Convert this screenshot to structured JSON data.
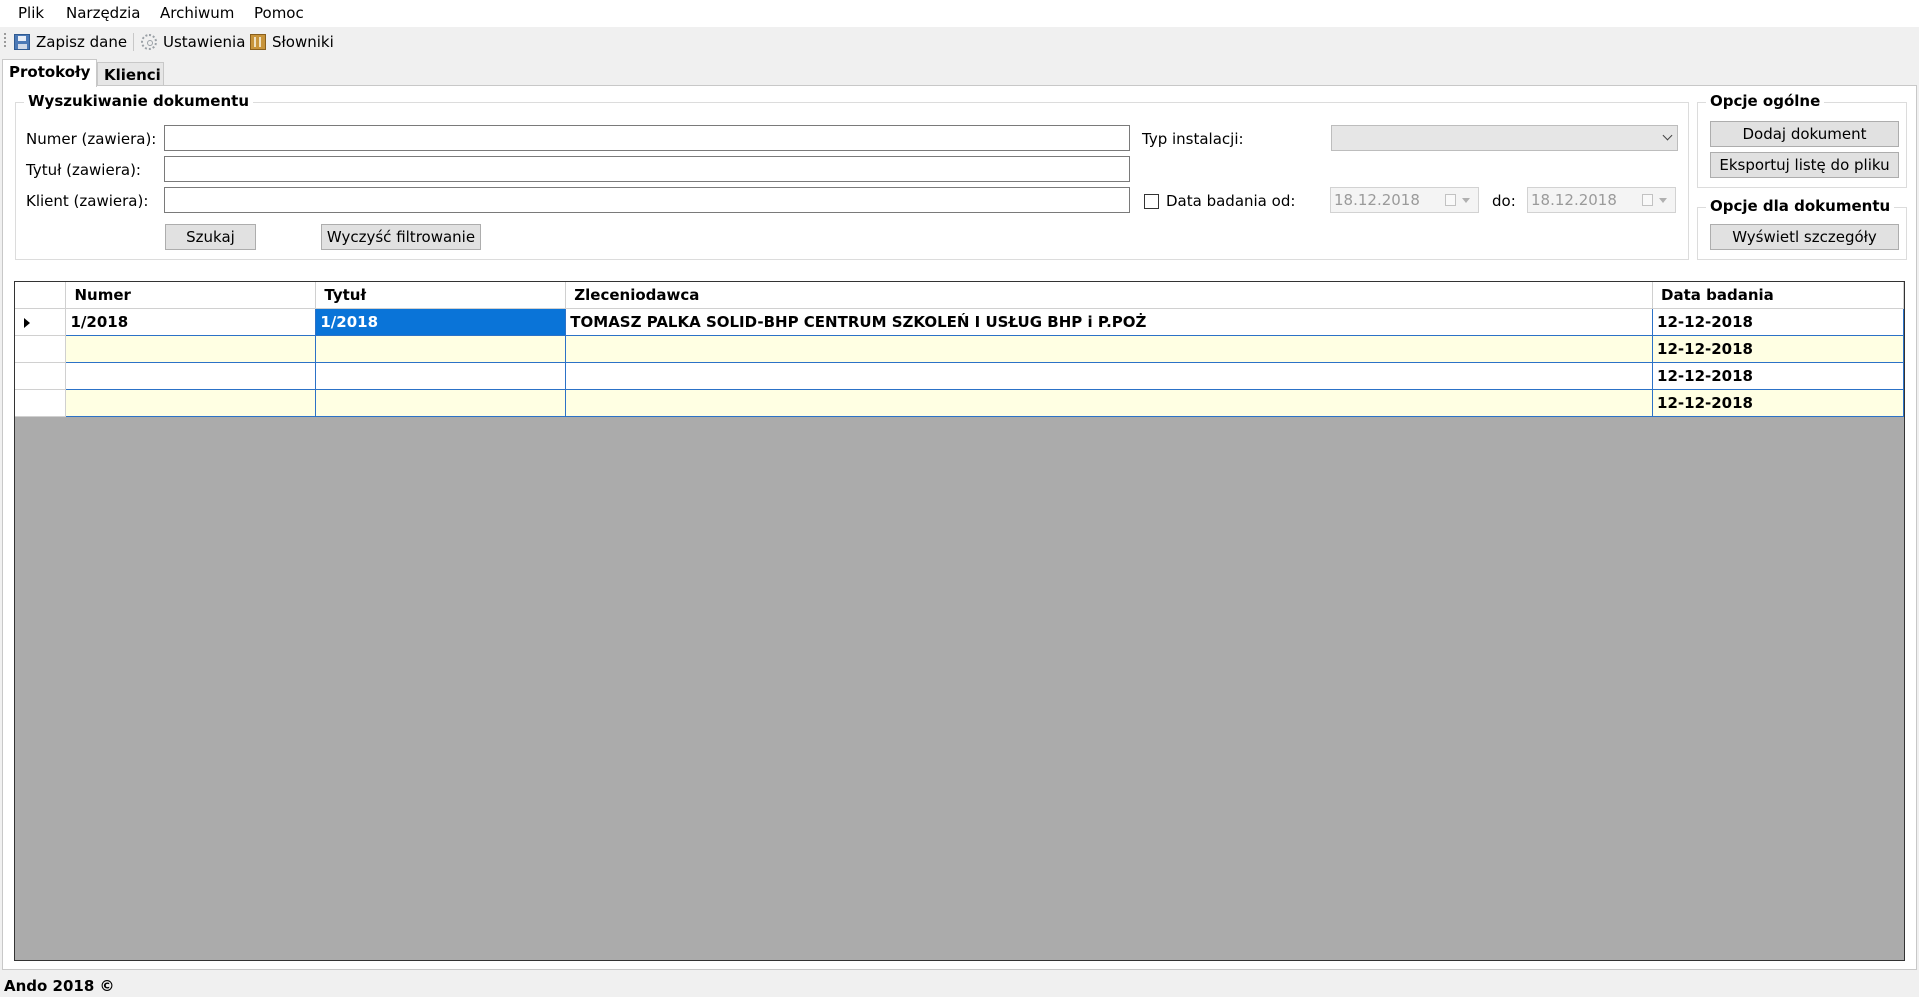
{
  "menu": {
    "items": [
      "Plik",
      "Narzędzia",
      "Archiwum",
      "Pomoc"
    ]
  },
  "toolbar": {
    "save_label": "Zapisz dane",
    "save_icon": "save-icon",
    "settings_label": "Ustawienia",
    "settings_icon": "gear-icon",
    "dictionaries_label": "Słowniki",
    "dictionaries_icon": "book-icon"
  },
  "tabs": [
    {
      "label": "Protokoły",
      "active": true
    },
    {
      "label": "Klienci",
      "active": false
    }
  ],
  "search": {
    "title": "Wyszukiwanie dokumentu",
    "number_label": "Numer (zawiera):",
    "number_value": "",
    "title_label": "Tytuł (zawiera):",
    "title_value": "",
    "client_label": "Klient (zawiera):",
    "client_value": "",
    "install_type_label": "Typ instalacji:",
    "install_type_value": "",
    "date_checkbox_label": "Data badania od:",
    "date_checked": false,
    "date_from": "18.12.2018",
    "date_to_label": "do:",
    "date_to": "18.12.2018",
    "search_button": "Szukaj",
    "clear_button": "Wyczyść filtrowanie"
  },
  "general_options": {
    "title": "Opcje ogólne",
    "add_button": "Dodaj dokument",
    "export_button": "Eksportuj listę do pliku"
  },
  "document_options": {
    "title": "Opcje dla dokumentu",
    "details_button": "Wyświetl szczegóły"
  },
  "grid": {
    "columns": [
      "Numer",
      "Tytuł",
      "Zleceniodawca",
      "Data badania"
    ],
    "rows": [
      {
        "numer": "1/2018",
        "tytul": "1/2018",
        "zleceniodawca": "TOMASZ PALKA SOLID-BHP CENTRUM SZKOLEŃ I USŁUG BHP i P.POŻ",
        "data": "12-12-2018"
      },
      {
        "numer": "",
        "tytul": "",
        "zleceniodawca": "",
        "data": "12-12-2018"
      },
      {
        "numer": "",
        "tytul": "",
        "zleceniodawca": "",
        "data": "12-12-2018"
      },
      {
        "numer": "",
        "tytul": "",
        "zleceniodawca": "",
        "data": "12-12-2018"
      }
    ]
  },
  "status": {
    "text": "Ando 2018 ©"
  },
  "colors": {
    "selection": "#0a74d8",
    "row_alt": "#ffffe3",
    "grid_empty": "#ababab"
  }
}
